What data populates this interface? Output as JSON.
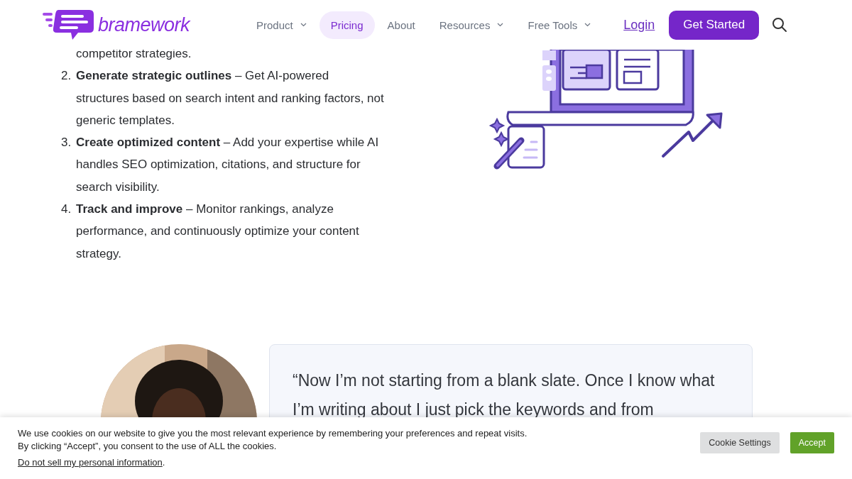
{
  "header": {
    "logo": "bramework",
    "nav": [
      {
        "label": "Product",
        "dropdown": true,
        "selected": false
      },
      {
        "label": "Pricing",
        "dropdown": false,
        "selected": true
      },
      {
        "label": "About",
        "dropdown": false,
        "selected": false
      },
      {
        "label": "Resources",
        "dropdown": true,
        "selected": false
      },
      {
        "label": "Free Tools",
        "dropdown": true,
        "selected": false
      }
    ],
    "login": "Login",
    "cta": "Get Started"
  },
  "steps": {
    "continuation": "competitor strategies.",
    "items": [
      {
        "number": "2.",
        "text": "**Generate strategic outlines** – Get AI-powered structures based on search intent and ranking factors, not generic templates."
      },
      {
        "number": "3.",
        "text": "**Create optimized content** – Add your expertise while AI handles SEO optimization, citations, and structure for search visibility."
      },
      {
        "number": "4.",
        "text": "**Track and improve** – Monitor rankings, analyze performance, and continuously optimize your content strategy."
      }
    ]
  },
  "testimonial": {
    "quote": "“Now I’m not starting from a blank slate. Once I know what I’m writing about I just pick the keywords and from"
  },
  "cookie_banner": {
    "lines": [
      "We use cookies on our website to give you the most relevant experience by remembering your preferences and repeat visits.",
      "By clicking “Accept”, you consent to the use of ALL the cookies."
    ],
    "link": "Do not sell my personal information",
    "link_suffix": ".",
    "buttons": [
      {
        "label": "Cookie Settings",
        "kind": "secondary"
      },
      {
        "label": "Accept",
        "kind": "primary"
      }
    ]
  }
}
